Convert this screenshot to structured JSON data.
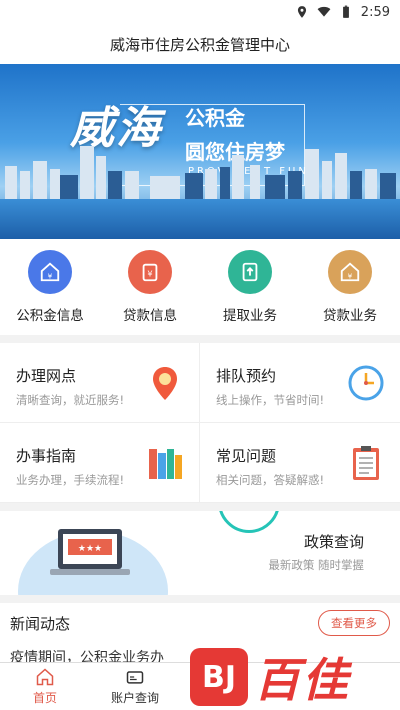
{
  "status_bar": {
    "time": "2:59"
  },
  "header": {
    "title": "威海市住房公积金管理中心"
  },
  "banner": {
    "calligraphy": "威海",
    "line1": "公积金",
    "line2": "圆您住房梦",
    "line3": "PROVIDENT FUND"
  },
  "quick_actions": [
    {
      "label": "公积金信息",
      "icon": "house-icon",
      "color": "#4a78e8"
    },
    {
      "label": "贷款信息",
      "icon": "loan-icon",
      "color": "#e8634c"
    },
    {
      "label": "提取业务",
      "icon": "withdraw-icon",
      "color": "#2fb596"
    },
    {
      "label": "贷款业务",
      "icon": "house-yen-icon",
      "color": "#d9a25a"
    }
  ],
  "services": [
    {
      "title": "办理网点",
      "subtitle": "清晰查询，就近服务!",
      "icon": "location-pin-icon"
    },
    {
      "title": "排队预约",
      "subtitle": "线上操作，节省时间!",
      "icon": "clock-icon"
    },
    {
      "title": "办事指南",
      "subtitle": "业务办理，手续流程!",
      "icon": "books-icon"
    },
    {
      "title": "常见问题",
      "subtitle": "相关问题，答疑解惑!",
      "icon": "clipboard-icon"
    }
  ],
  "policy": {
    "title": "政策查询",
    "subtitle": "最新政策 随时掌握"
  },
  "news": {
    "title": "新闻动态",
    "more_label": "查看更多",
    "first_item": "疫情期间，公积金业务办"
  },
  "tabs": [
    {
      "label": "首页",
      "icon": "home-icon",
      "active": true
    },
    {
      "label": "账户查询",
      "icon": "card-icon",
      "active": false
    }
  ],
  "watermark": {
    "logo": "BJ",
    "text": "百佳"
  }
}
